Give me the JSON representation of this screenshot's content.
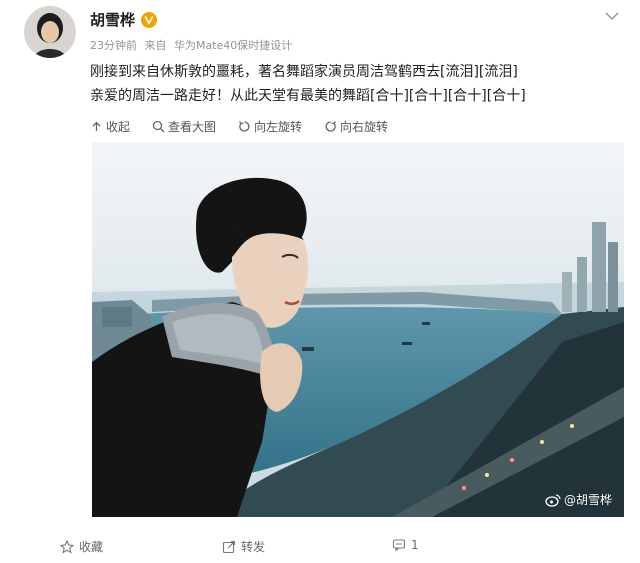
{
  "post": {
    "author": {
      "name": "胡雪桦",
      "verified_icon": "verified-badge-icon",
      "avatar_icon": "avatar"
    },
    "meta": {
      "time": "23分钟前",
      "source_prefix": "来自",
      "device": "华为Mate40保时捷设计"
    },
    "text": {
      "line1": "刚接到来自休斯敦的噩耗，著名舞蹈家演员周洁驾鹤西去[流泪][流泪]",
      "line2": "亲爱的周洁一路走好！从此天堂有最美的舞蹈[合十][合十][合十][合十]"
    },
    "image_toolbar": {
      "collapse": "收起",
      "view_large": "查看大图",
      "rotate_left": "向左旋转",
      "rotate_right": "向右旋转"
    },
    "watermark": "@胡雪桦",
    "actions": {
      "favorite": "收藏",
      "repost": "转发",
      "comment_count": "1"
    }
  },
  "colors": {
    "verified": "#f2a300",
    "text": "#222222",
    "meta": "#939393"
  }
}
